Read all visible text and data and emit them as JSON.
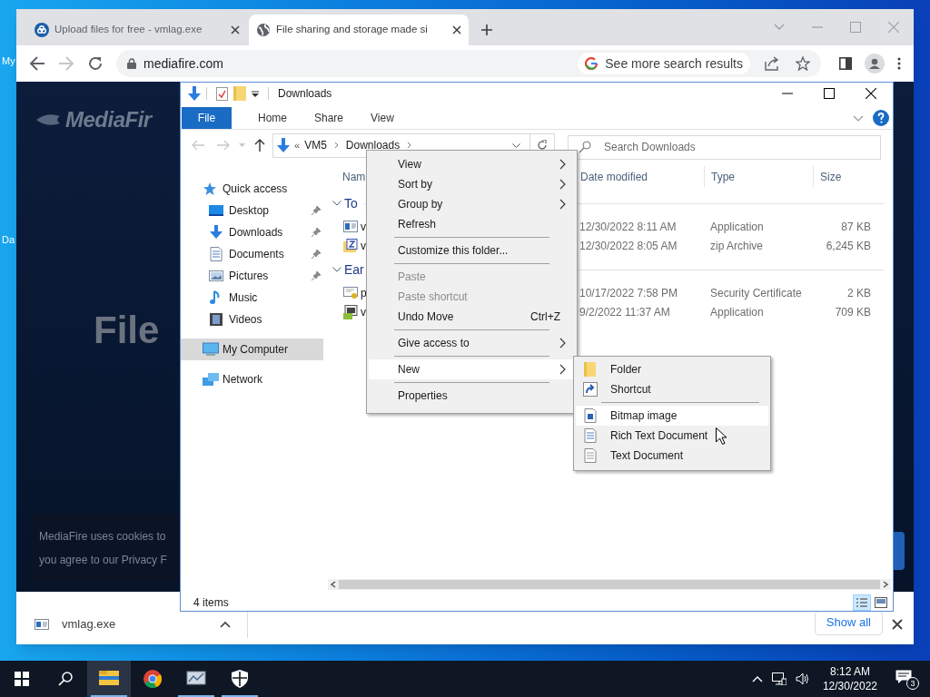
{
  "desktop": {
    "icon_labels": [
      "My",
      "Da"
    ]
  },
  "browser": {
    "tabs": [
      {
        "title": "Upload files for free - vmlag.exe",
        "kind": "cloud",
        "selected": false
      },
      {
        "title": "File sharing and storage made si",
        "kind": "globe",
        "selected": true
      }
    ],
    "address": "mediafire.com",
    "search_chip": "See more search results",
    "page": {
      "logo": "MediaFir",
      "heading": "File",
      "cookie_lines": [
        "MediaFire uses cookies to",
        "you agree to our Privacy F"
      ]
    },
    "download_bar": {
      "file": "vmlag.exe",
      "show_all": "Show all"
    }
  },
  "explorer": {
    "title": "Downloads",
    "ribbon_tabs": [
      {
        "label": "File",
        "selected": true
      },
      {
        "label": "Home",
        "selected": false
      },
      {
        "label": "Share",
        "selected": false
      },
      {
        "label": "View",
        "selected": false
      }
    ],
    "breadcrumb_prefix": "«",
    "breadcrumb": [
      "VM5",
      "Downloads"
    ],
    "search_placeholder": "Search Downloads",
    "nav": [
      {
        "label": "Quick access",
        "kind": "star",
        "selected": false,
        "children": [
          {
            "label": "Desktop",
            "kind": "desktop",
            "pinned": true,
            "selected": false
          },
          {
            "label": "Downloads",
            "kind": "download",
            "pinned": true,
            "selected": false
          },
          {
            "label": "Documents",
            "kind": "document",
            "pinned": true,
            "selected": false
          },
          {
            "label": "Pictures",
            "kind": "pictures",
            "pinned": true,
            "selected": false
          },
          {
            "label": "Music",
            "kind": "music",
            "pinned": false,
            "selected": false
          },
          {
            "label": "Videos",
            "kind": "videos",
            "pinned": false,
            "selected": false
          }
        ]
      },
      {
        "label": "My Computer",
        "kind": "computer",
        "selected": true
      },
      {
        "label": "Network",
        "kind": "network",
        "selected": false
      }
    ],
    "columns": [
      "Nam",
      "Date modified",
      "Type",
      "Size"
    ],
    "groups": [
      {
        "label": "To",
        "rows": [
          {
            "kind": "application",
            "name": "v",
            "date": "12/30/2022 8:11 AM",
            "type": "Application",
            "size": "87 KB"
          },
          {
            "kind": "zip",
            "name": "v",
            "date": "12/30/2022 8:05 AM",
            "type": "zip Archive",
            "size": "6,245 KB"
          }
        ]
      },
      {
        "label": "Ear",
        "rows": [
          {
            "kind": "certificate",
            "name": "p",
            "date": "10/17/2022 7:58 PM",
            "type": "Security Certificate",
            "size": "2 KB"
          },
          {
            "kind": "installer",
            "name": "v",
            "date": "9/2/2022 11:37 AM",
            "type": "Application",
            "size": "709 KB"
          }
        ]
      }
    ],
    "status": "4 items"
  },
  "context_menu": [
    {
      "kind": "item",
      "label": "View",
      "submenu": true,
      "disabled": false,
      "selected": false
    },
    {
      "kind": "item",
      "label": "Sort by",
      "submenu": true,
      "disabled": false,
      "selected": false
    },
    {
      "kind": "item",
      "label": "Group by",
      "submenu": true,
      "disabled": false,
      "selected": false
    },
    {
      "kind": "item",
      "label": "Refresh",
      "submenu": false,
      "disabled": false,
      "selected": false
    },
    {
      "kind": "separator"
    },
    {
      "kind": "item",
      "label": "Customize this folder...",
      "submenu": false,
      "disabled": false,
      "selected": false
    },
    {
      "kind": "separator"
    },
    {
      "kind": "item",
      "label": "Paste",
      "submenu": false,
      "disabled": true,
      "selected": false
    },
    {
      "kind": "item",
      "label": "Paste shortcut",
      "submenu": false,
      "disabled": true,
      "selected": false
    },
    {
      "kind": "item",
      "label": "Undo Move",
      "shortcut": "Ctrl+Z",
      "submenu": false,
      "disabled": false,
      "selected": false
    },
    {
      "kind": "separator"
    },
    {
      "kind": "item",
      "label": "Give access to",
      "submenu": true,
      "disabled": false,
      "selected": false
    },
    {
      "kind": "separator"
    },
    {
      "kind": "item",
      "label": "New",
      "submenu": true,
      "disabled": false,
      "selected": true
    },
    {
      "kind": "separator"
    },
    {
      "kind": "item",
      "label": "Properties",
      "submenu": false,
      "disabled": false,
      "selected": false
    }
  ],
  "new_submenu": [
    {
      "kind": "folder",
      "label": "Folder",
      "selected": false
    },
    {
      "kind": "shortcut",
      "label": "Shortcut",
      "selected": false
    },
    {
      "kind": "separator"
    },
    {
      "kind": "bitmap",
      "label": "Bitmap image",
      "selected": true
    },
    {
      "kind": "richtext",
      "label": "Rich Text Document",
      "selected": false
    },
    {
      "kind": "text",
      "label": "Text Document",
      "selected": false
    }
  ],
  "taskbar": {
    "apps": [
      {
        "kind": "explorer",
        "selected": true,
        "running": true
      },
      {
        "kind": "chrome",
        "selected": false,
        "running": false
      },
      {
        "kind": "monitor",
        "selected": false,
        "running": true
      },
      {
        "kind": "shield",
        "selected": false,
        "running": true
      }
    ],
    "time": "8:12 AM",
    "date": "12/30/2022",
    "notifications": "3"
  }
}
